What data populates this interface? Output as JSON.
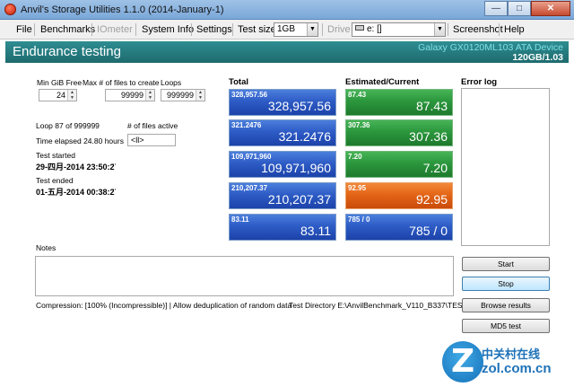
{
  "window": {
    "title": "Anvil's Storage Utilities 1.1.0 (2014-January-1)"
  },
  "menu": {
    "file": "File",
    "benchmarks": "Benchmarks",
    "iometer": "IOmeter",
    "system_info": "System Info",
    "settings": "Settings",
    "test_size_label": "Test size",
    "test_size_value": "1GB",
    "drive_label": "Drive",
    "drive_value": "e: []",
    "screenshot": "Screenshot",
    "help": "Help"
  },
  "header": {
    "title": "Endurance testing",
    "device_name": "Galaxy GX0120ML103 ATA Device",
    "device_capacity": "120GB/1.03"
  },
  "params": {
    "min_free_label": "Min GiB Free",
    "min_free_value": "24",
    "max_files_label": "Max # of files to create",
    "max_files_value": "99999",
    "loops_label": "Loops",
    "loops_value": "999999"
  },
  "status": {
    "loop_text": "Loop 87 of 999999",
    "files_active_label": "# of files active",
    "files_active_value": "<ll>",
    "elapsed_text": "Time elapsed 24.80 hours",
    "test_started_label": "Test started",
    "test_started_value": "29-四月-2014 23:50:2̈",
    "test_ended_label": "Test ended",
    "test_ended_value": "01-五月-2014 00:38:2̈"
  },
  "columns": {
    "total": "Total",
    "estimated": "Estimated/Current",
    "error_log": "Error log"
  },
  "total_tiles": [
    {
      "small": "328,957.56",
      "big": "328,957.56"
    },
    {
      "small": "321.2476",
      "big": "321.2476"
    },
    {
      "small": "109,971,960",
      "big": "109,971,960"
    },
    {
      "small": "210,207.37",
      "big": "210,207.37"
    },
    {
      "small": "83.11",
      "big": "83.11"
    }
  ],
  "estimated_tiles": [
    {
      "small": "87.43",
      "big": "87.43",
      "color": "green"
    },
    {
      "small": "307.36",
      "big": "307.36",
      "color": "green"
    },
    {
      "small": "7.20",
      "big": "7.20",
      "color": "green"
    },
    {
      "small": "92.95",
      "big": "92.95",
      "color": "orange"
    },
    {
      "small": "785 / 0",
      "big": "785 / 0",
      "color": "blue"
    }
  ],
  "notes_label": "Notes",
  "footer": {
    "compression": "Compression: [100% (Incompressible)] | Allow deduplication of random data",
    "test_directory": "Test Directory E:\\AnvilBenchmark_V110_B337\\TEST"
  },
  "buttons": {
    "start": "Start",
    "stop": "Stop",
    "browse_results": "Browse results",
    "md5_test": "MD5 test"
  },
  "watermark": {
    "cn": "中关村在线",
    "url": "zol.com.cn"
  },
  "colors": {
    "header_bg": "#1e6b6e",
    "tile_blue": "#2e5cc6",
    "tile_green": "#2c973d",
    "tile_orange": "#e46517"
  }
}
